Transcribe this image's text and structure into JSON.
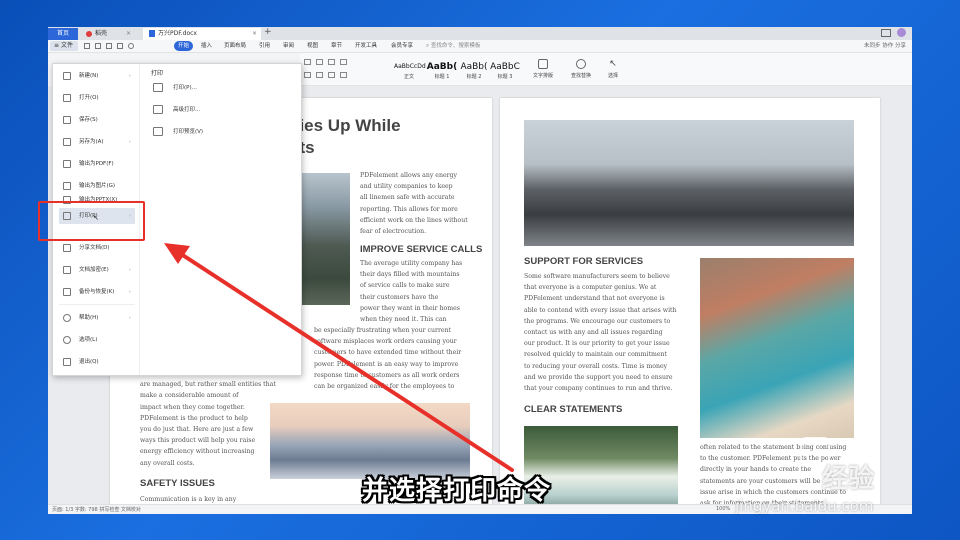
{
  "titlebar": {
    "home_tab": "首页",
    "wps_tab": "稻壳",
    "doc_tab": "万兴PDF.docx",
    "add_tab": "+"
  },
  "menubar": {
    "file": "文件",
    "tabs": [
      "开始",
      "插入",
      "页面布局",
      "引用",
      "审阅",
      "视图",
      "章节",
      "开发工具",
      "会员专享"
    ],
    "search": "查找命令、搜索模板",
    "right": "未同步 协作 分享"
  },
  "ribbon": {
    "styles": [
      {
        "preview": "AaBbCcDd",
        "label": "正文"
      },
      {
        "preview": "AaBb(",
        "label": "标题 1"
      },
      {
        "preview": "AaBb(",
        "label": "标题 2"
      },
      {
        "preview": "AaBbC",
        "label": "标题 3"
      }
    ],
    "tools": [
      "文字排版",
      "查找替换",
      "选择"
    ]
  },
  "file_menu": {
    "items": [
      {
        "label": "新建(N)",
        "arrow": true
      },
      {
        "label": "打开(O)",
        "arrow": false
      },
      {
        "label": "保存(S)",
        "arrow": false
      },
      {
        "label": "另存为(A)",
        "arrow": true
      },
      {
        "label": "输出为PDF(F)",
        "arrow": false
      },
      {
        "label": "输出为图片(G)",
        "arrow": false
      },
      {
        "label": "输出为PPTX(X)",
        "arrow": false
      },
      {
        "label": "打印(P)",
        "arrow": true
      },
      {
        "label": "分享文档(D)",
        "arrow": false
      },
      {
        "label": "文档加密(E)",
        "arrow": true
      },
      {
        "label": "备份与恢复(K)",
        "arrow": true
      },
      {
        "label": "帮助(H)",
        "arrow": true
      },
      {
        "label": "选项(L)",
        "arrow": false
      },
      {
        "label": "退出(Q)",
        "arrow": false
      }
    ],
    "submenu_title": "打印",
    "submenu": [
      "打印(P)...",
      "高级打印...",
      "打印预览(V)"
    ]
  },
  "document": {
    "left_heading": "cies Up While",
    "left_heading2": "sts",
    "left_p1": [
      "PDFelement allows any energy",
      "and utility companies to keep",
      "all linemen safe with accurate",
      "reporting. This allows for more",
      "efficient work on the lines without",
      "fear of electrocution."
    ],
    "improve_heading": "IMPROVE SERVICE CALLS",
    "improve_p": [
      "The average utility company has",
      "their days filled with mountains",
      "of service calls to make sure",
      "their customers have the",
      "power they want in their homes",
      "when they need it. This can",
      "be especially frustrating when your current",
      "software misplaces work orders causing your",
      "customers to have extended time without their",
      "power. PDFelement is an easy way to improve",
      "response time to customers as all work orders",
      "can be organized easily for the employees to"
    ],
    "left_lower_p": [
      "take drastic measures to ensure that finances",
      "are managed, but rather small entities that",
      "make a considerable amount of",
      "impact when they come together.",
      "PDFelement is the product to help",
      "you do just that. Here are just a few",
      "ways this product will help you raise",
      "energy efficiency without increasing",
      "any overall costs."
    ],
    "safety_heading": "SAFETY ISSUES",
    "safety_p": "Communication is a key in any",
    "support_heading": "SUPPORT FOR SERVICES",
    "support_p": [
      "Some software manufacturers seem to believe",
      "that everyone is a computer genius. We at",
      "PDFelement understand that not everyone is",
      "able to contend with every issue that arises with",
      "the programs. We encourage our customers to",
      "contact us with any and all issues regarding",
      "our product. It is our priority to get your issue",
      "resolved quickly to maintain our commitment",
      "to reducing your overall costs. Time is money",
      "and we provide the support you need to ensure",
      "that your company continues to run and thrive."
    ],
    "clear_heading": "CLEAR STATEMENTS",
    "right_lower_p": [
      "often related to the statement being confusing",
      "to the customer. PDFelement puts the power",
      "directly in your hands to create the",
      "statements are your customers will be",
      "issue arise in which the customers continue to",
      "ask for information on their statements."
    ]
  },
  "statusbar": {
    "left": "页面: 1/3   字数: 798   拼写检查   文档校对",
    "right": "100%"
  },
  "annotation": {
    "caption": "并选择打印命令",
    "watermark": "经验",
    "watermark_url": "jingyan.baidu.com",
    "highlight_color": "#e8302a"
  }
}
